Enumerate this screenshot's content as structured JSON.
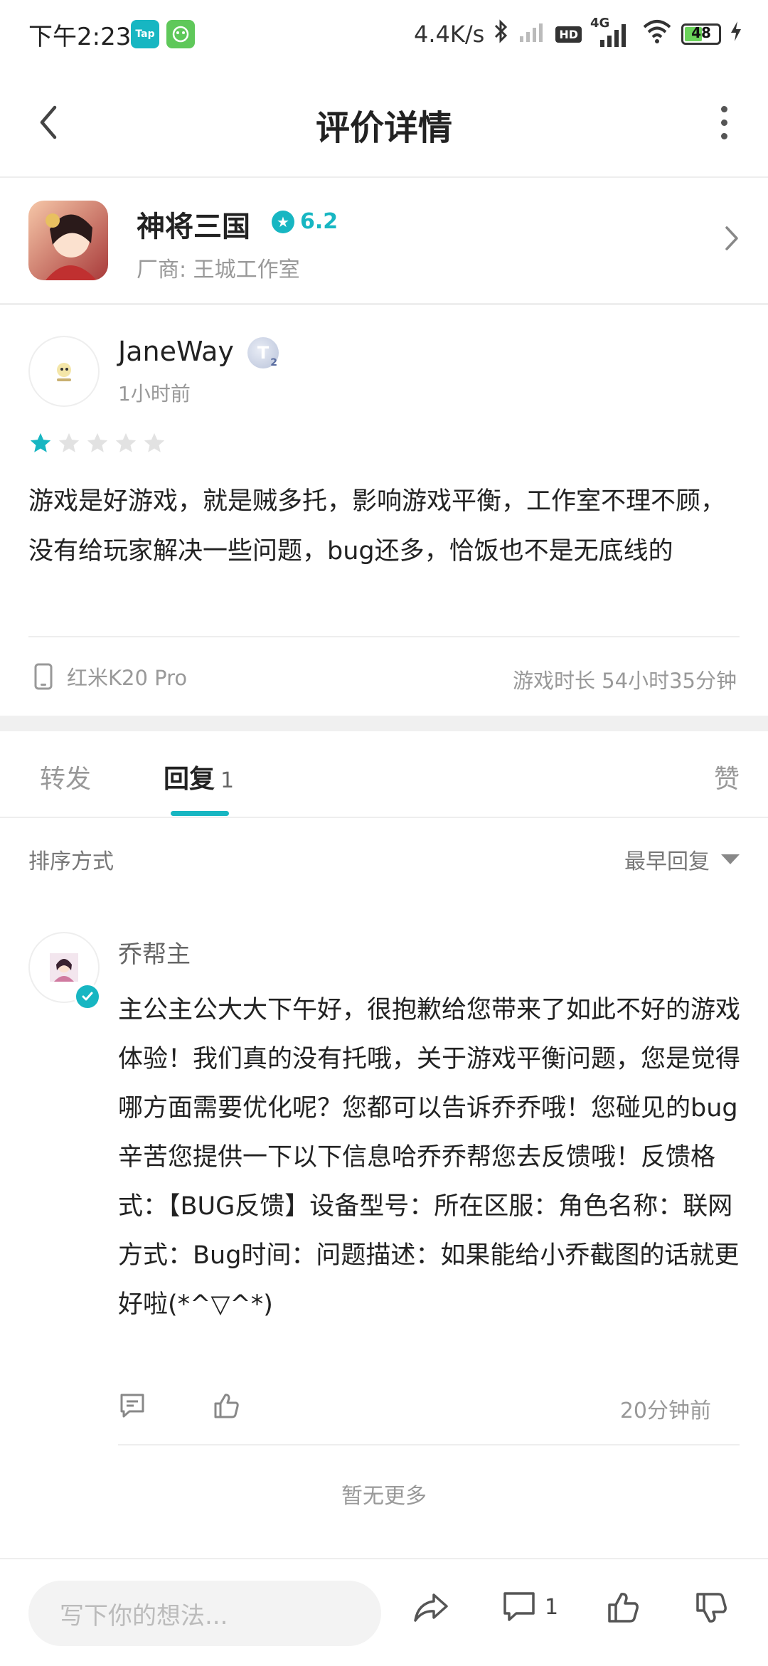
{
  "status_bar": {
    "time": "下午2:23",
    "app_badge_1": "Tap",
    "net_speed": "4.4K/s",
    "hd_label": "HD",
    "signal_label": "4G",
    "battery": "48"
  },
  "header": {
    "title": "评价详情"
  },
  "game": {
    "name": "神将三国",
    "rating": "6.2",
    "vendor": "厂商: 王城工作室"
  },
  "review": {
    "username": "JaneWay",
    "level": "T",
    "level_sub": "2",
    "time": "1小时前",
    "stars": 1,
    "stars_max": 5,
    "text": "游戏是好游戏，就是贼多托，影响游戏平衡，工作室不理不顾，没有给玩家解决一些问题，bug还多，恰饭也不是无底线的",
    "device": "红米K20 Pro",
    "playtime": "游戏时长 54小时35分钟"
  },
  "tabs": [
    {
      "label": "转发"
    },
    {
      "label": "回复",
      "count": "1"
    },
    {
      "label": "赞"
    }
  ],
  "sort": {
    "label": "排序方式",
    "value": "最早回复"
  },
  "reply": {
    "username": "乔帮主",
    "text": "主公主公大大下午好，很抱歉给您带来了如此不好的游戏体验！我们真的没有托哦，关于游戏平衡问题，您是觉得哪方面需要优化呢？您都可以告诉乔乔哦！您碰见的bug辛苦您提供一下以下信息哈乔乔帮您去反馈哦！反馈格式：【BUG反馈】设备型号：所在区服：角色名称：联网方式：Bug时间：问题描述：如果能给小乔截图的话就更好啦(*^▽^*)",
    "time": "20分钟前"
  },
  "no_more": "暂无更多",
  "bottom_bar": {
    "input_placeholder": "写下你的想法...",
    "comment_count": "1"
  },
  "colors": {
    "accent": "#17b6c2",
    "star_empty": "#e2e2e2"
  }
}
